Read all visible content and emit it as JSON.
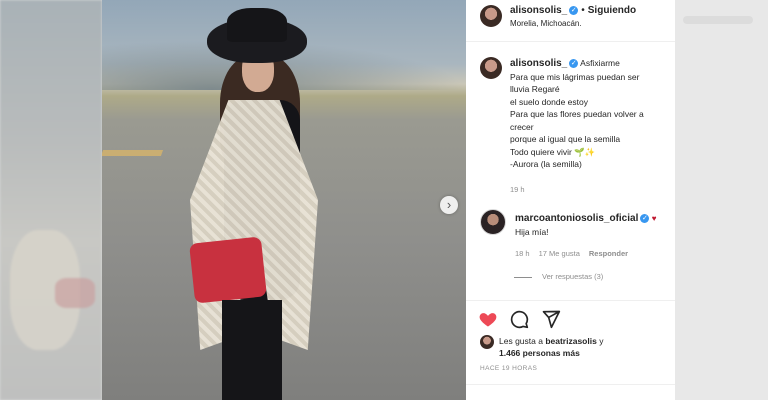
{
  "post": {
    "author": "alisonsolis_",
    "follow_status": "Siguiendo",
    "location": "Morelia, Michoacán.",
    "caption_lines": [
      "Asfixiarme",
      "Para que mis lágrimas puedan ser",
      "lluvia Regaré",
      "el suelo donde estoy",
      "Para que las flores puedan volver a",
      "crecer",
      "porque al igual que la semilla",
      "Todo quiere vivir 🌱✨",
      "-Aurora (la semilla)"
    ],
    "caption_time": "19 h"
  },
  "comment": {
    "author": "marcoantoniosolis_oficial",
    "text": "Hija mía!",
    "time": "18 h",
    "likes": "17 Me gusta",
    "reply_label": "Responder",
    "view_replies": "Ver respuestas (3)"
  },
  "likes": {
    "prefix": "Les gusta a",
    "first_liker": "beatrizasolis",
    "conj": "y",
    "others": "1.466 personas más"
  },
  "time_ago": "HACE 19 HORAS",
  "colors": {
    "verified": "#3897f0",
    "like_heart": "#ed4956",
    "comment_heart": "#c0172f",
    "text_primary": "#262626",
    "text_secondary": "#8e8e8e"
  },
  "icons": [
    "verified-badge-icon",
    "heart-icon",
    "comment-icon",
    "share-icon",
    "next-arrow-icon"
  ]
}
